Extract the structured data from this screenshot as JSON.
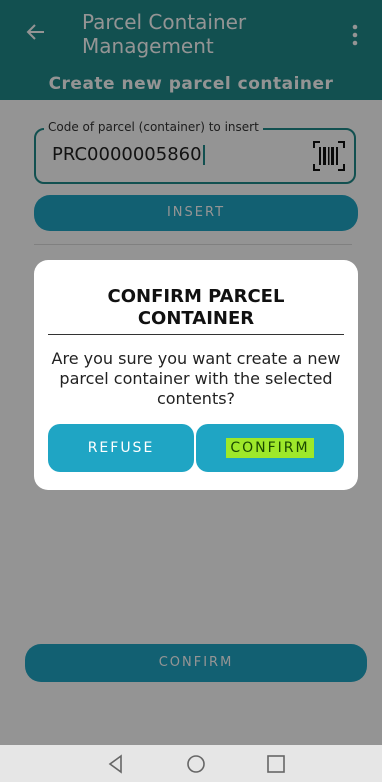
{
  "header": {
    "title": "Parcel Container Management",
    "subtitle": "Create new parcel container"
  },
  "field": {
    "label": "Code of parcel (container) to insert",
    "value": "PRC0000005860"
  },
  "buttons": {
    "insert": "INSERT",
    "confirm_main": "CONFIRM"
  },
  "dialog": {
    "title_line1": "CONFIRM PARCEL",
    "title_line2": "CONTAINER",
    "message": "Are you sure you want create a new parcel container with the selected contents?",
    "refuse": "REFUSE",
    "confirm": "CONFIRM"
  },
  "icons": [
    "back-arrow-icon",
    "more-vert-icon",
    "barcode-icon",
    "nav-back-icon",
    "nav-home-icon",
    "nav-recents-icon"
  ],
  "colors": {
    "appbar": "#1f8b8b",
    "button": "#1fa5c4",
    "highlight": "#9ee82a"
  }
}
